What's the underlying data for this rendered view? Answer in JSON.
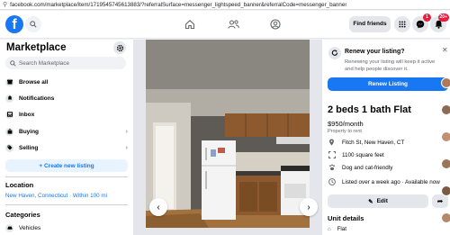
{
  "browser": {
    "url": "facebook.com/marketplace/item/1719545745613883/?referralSurface=messenger_lightspeed_banner&referralCode=messenger_banner"
  },
  "topnav": {
    "find_friends": "Find friends",
    "messenger_badge": "1",
    "notifications_badge": "20+"
  },
  "sidebar": {
    "title": "Marketplace",
    "search_placeholder": "Search Marketplace",
    "items": [
      {
        "label": "Browse all"
      },
      {
        "label": "Notifications"
      },
      {
        "label": "Inbox"
      },
      {
        "label": "Buying"
      },
      {
        "label": "Selling"
      }
    ],
    "create_listing": "+ Create new listing",
    "location_heading": "Location",
    "location_value": "New Haven, Connecticut · Within 100 mi",
    "categories_heading": "Categories",
    "first_category": "Vehicles"
  },
  "detail": {
    "prompt_title": "Renew your listing?",
    "prompt_body": "Renewing your listing will keep it active and help people discover it.",
    "renew_button": "Renew Listing",
    "listing_title": "2 beds 1 bath Flat",
    "price": "$950/month",
    "listing_type": "Property to rent",
    "attributes": [
      {
        "icon": "location-pin-icon",
        "text": "Fitch St, New Haven, CT"
      },
      {
        "icon": "ruler-icon",
        "text": "1100 square feet"
      },
      {
        "icon": "paw-icon",
        "text": "Dog and cat-friendly"
      },
      {
        "icon": "clock-icon",
        "text": "Listed over a week ago · Available now"
      }
    ],
    "edit_button": "Edit",
    "unit_details_heading": "Unit details",
    "unit_first": "Flat"
  },
  "colors": {
    "brand": "#1877f2",
    "badge": "#e41e3f"
  }
}
